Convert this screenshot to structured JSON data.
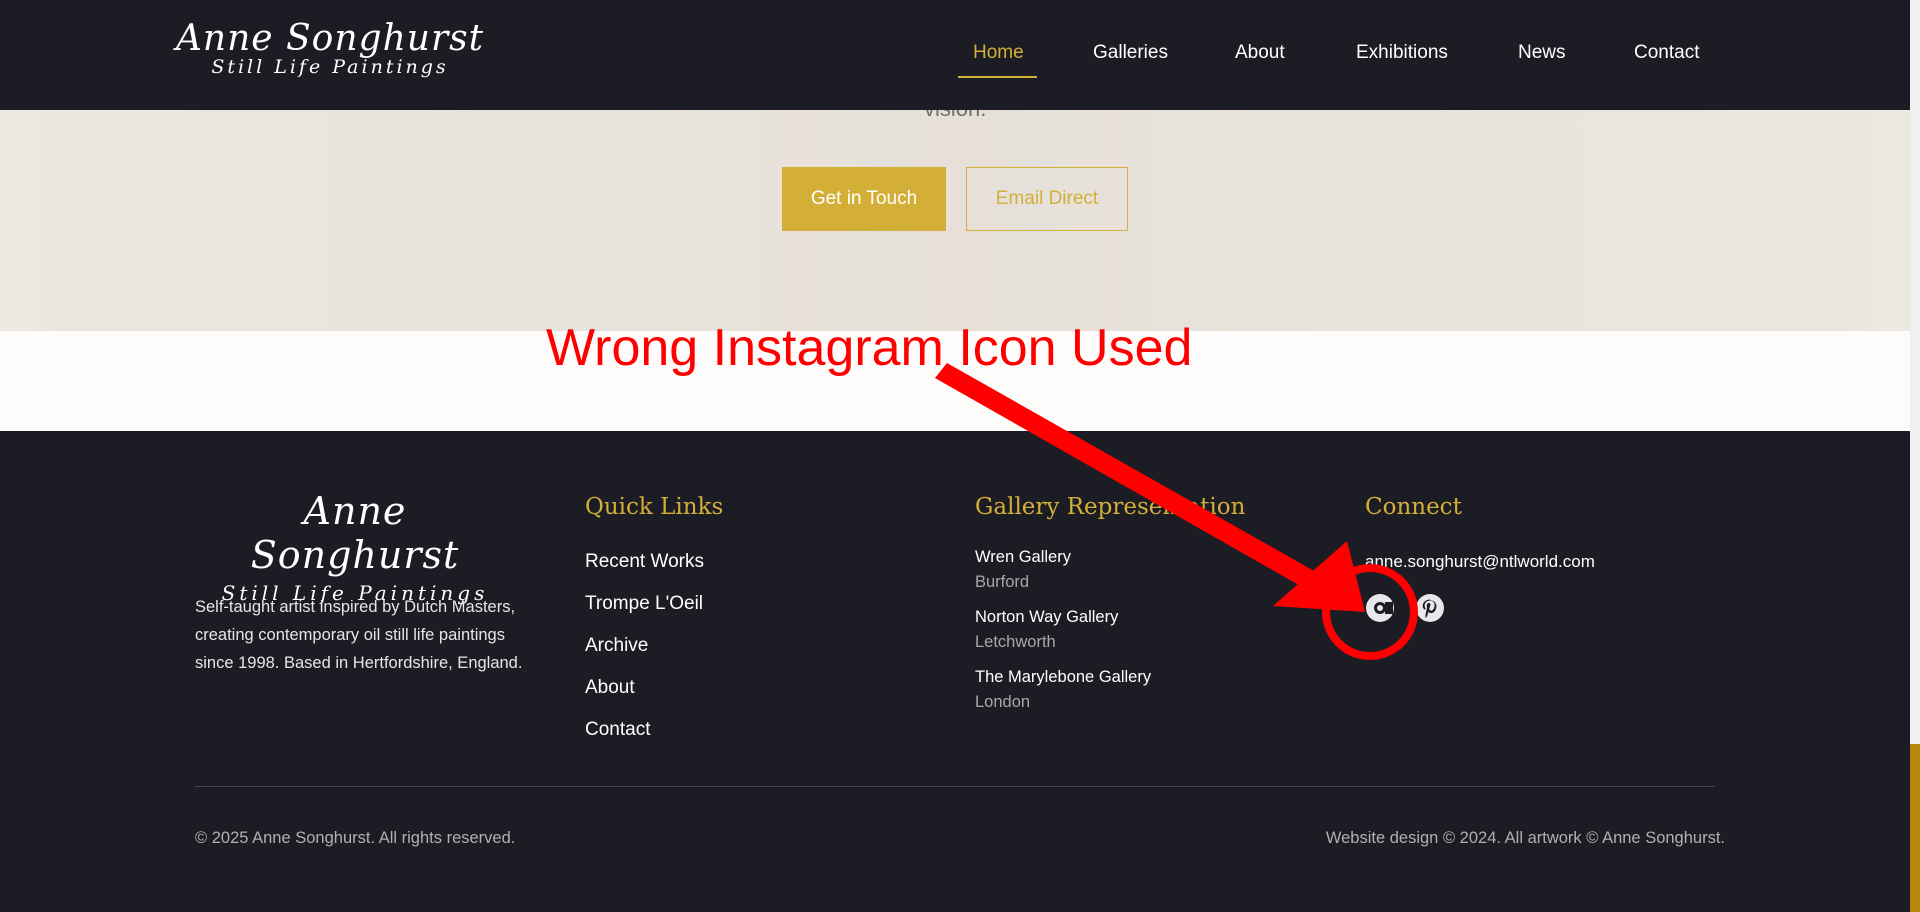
{
  "header": {
    "logo_line1": "Anne Songhurst",
    "logo_line2": "Still Life Paintings",
    "nav": [
      "Home",
      "Galleries",
      "About",
      "Exhibitions",
      "News",
      "Contact"
    ],
    "active": "Home"
  },
  "cta": {
    "partial_text": "vision.",
    "primary_label": "Get in Touch",
    "secondary_label": "Email Direct"
  },
  "annotation": {
    "text": "Wrong Instagram Icon Used",
    "color": "#ff0000"
  },
  "footer": {
    "logo_line1": "Anne Songhurst",
    "logo_line2": "Still Life Paintings",
    "description": "Self-taught artist inspired by Dutch Masters, creating contemporary oil still life paintings since 1998. Based in Hertfordshire, England.",
    "quick_links_title": "Quick Links",
    "quick_links": [
      "Recent Works",
      "Trompe L'Oeil",
      "Archive",
      "About",
      "Contact"
    ],
    "gallery_title": "Gallery Representation",
    "galleries": [
      {
        "name": "Wren Gallery",
        "location": "Burford"
      },
      {
        "name": "Norton Way Gallery",
        "location": "Letchworth"
      },
      {
        "name": "The Marylebone Gallery",
        "location": "London"
      }
    ],
    "connect_title": "Connect",
    "email": "anne.songhurst@ntlworld.com",
    "social_icons": [
      "camera-icon",
      "pinterest-icon"
    ],
    "copyright": "© 2025 Anne Songhurst. All rights reserved.",
    "credits": "Website design © 2024. All artwork © Anne Songhurst."
  },
  "colors": {
    "accent": "#d4af37",
    "dark_bg": "#1c1c24"
  }
}
